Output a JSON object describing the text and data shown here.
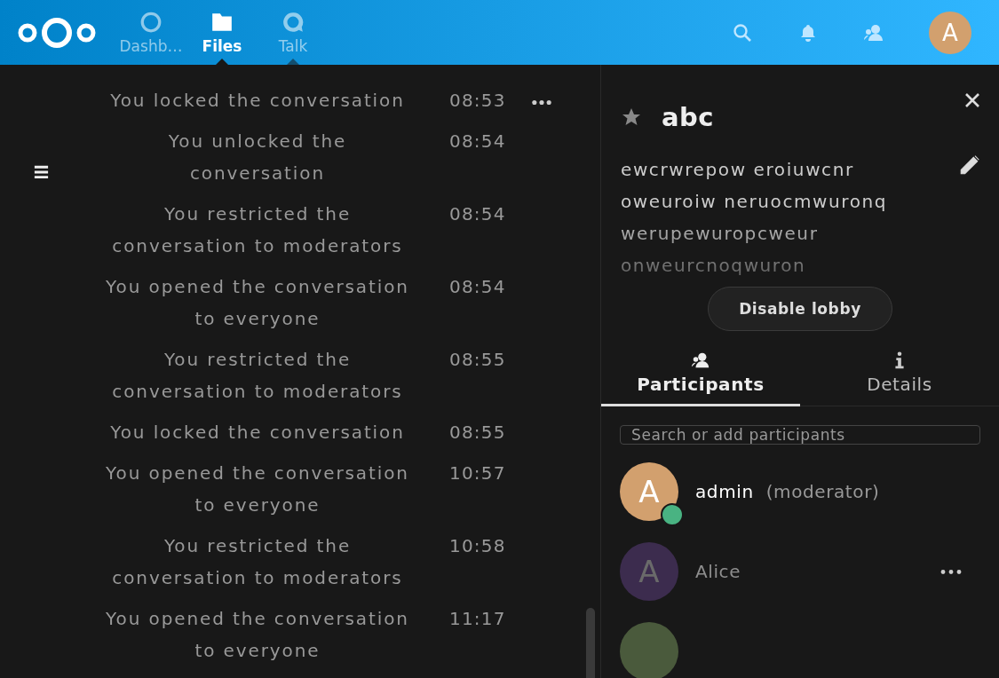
{
  "header": {
    "apps": [
      {
        "label": "Dashb…",
        "kind": "dashboard",
        "selected": false,
        "indicator": false
      },
      {
        "label": "Files",
        "kind": "files",
        "selected": true,
        "indicator": true
      },
      {
        "label": "Talk",
        "kind": "talk",
        "selected": false,
        "indicator": true
      }
    ],
    "avatar": "A"
  },
  "messages": [
    {
      "text": "You locked the conversation",
      "time": "08:53"
    },
    {
      "text": "You unlocked the conversation",
      "time": "08:54"
    },
    {
      "text": "You restricted the conversation to moderators",
      "time": "08:54"
    },
    {
      "text": "You opened the conversation to everyone",
      "time": "08:54"
    },
    {
      "text": "You restricted the conversation to moderators",
      "time": "08:55"
    },
    {
      "text": "You locked the conversation",
      "time": "08:55"
    },
    {
      "text": "You opened the conversation to everyone",
      "time": "10:57"
    },
    {
      "text": "You restricted the conversation to moderators",
      "time": "10:58"
    },
    {
      "text": "You opened the conversation to everyone",
      "time": "11:17"
    }
  ],
  "sidebar": {
    "title": "abc",
    "favorite": false,
    "description": "ewcrwrepow eroiuwcnr oweuroiw neruocmwuronq werupewuropcweur onweurcnoqwuron",
    "lobby_button": "Disable lobby",
    "tabs": [
      {
        "label": "Participants",
        "kind": "participants",
        "selected": true
      },
      {
        "label": "Details",
        "kind": "details",
        "selected": false
      }
    ],
    "search": {
      "placeholder": "Search or add participants"
    },
    "participants": [
      {
        "initial": "A",
        "name": "admin",
        "role": "(moderator)",
        "color": "#d2a06e",
        "online": true,
        "actions": false,
        "active": true
      },
      {
        "initial": "A",
        "name": "Alice",
        "color": "#3c2c4e",
        "online": false,
        "actions": true,
        "active": false
      },
      {
        "color": "#4a5a3c",
        "online": false,
        "actions": false
      }
    ]
  }
}
